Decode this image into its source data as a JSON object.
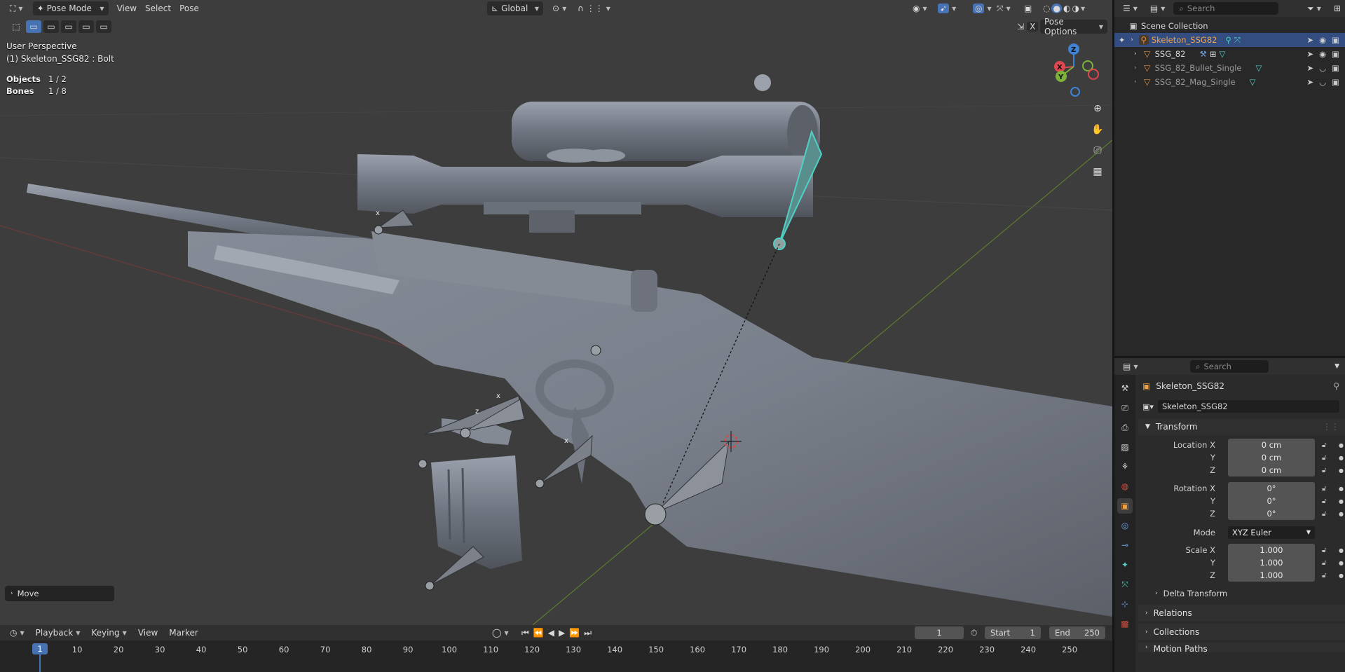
{
  "viewport": {
    "mode": "Pose Mode",
    "menus": [
      "View",
      "Select",
      "Pose"
    ],
    "orientation": "Global",
    "pose_options": "Pose Options",
    "x_toggle": "X",
    "perspective": "User Perspective",
    "active": "(1) Skeleton_SSG82 : Bolt",
    "stats": [
      {
        "label": "Objects",
        "value": "1 / 2"
      },
      {
        "label": "Bones",
        "value": "1 / 8"
      }
    ],
    "gizmo": {
      "x": "X",
      "y": "Y",
      "z": "Z"
    },
    "operator_panel": "Move",
    "bone_axis_labels": [
      "x",
      "z",
      "x",
      "x"
    ],
    "nav_icons": [
      "zoom-icon",
      "hand-icon",
      "camera-icon",
      "grid-icon"
    ]
  },
  "outliner": {
    "search_placeholder": "Search",
    "root": "Scene Collection",
    "items": [
      {
        "name": "Skeleton_SSG82",
        "selected": true
      },
      {
        "name": "SSG_82",
        "selected": false
      },
      {
        "name": "SSG_82_Bullet_Single",
        "selected": false
      },
      {
        "name": "SSG_82_Mag_Single",
        "selected": false
      }
    ]
  },
  "properties": {
    "search_placeholder": "Search",
    "object_title": "Skeleton_SSG82",
    "object_name": "Skeleton_SSG82",
    "transform_label": "Transform",
    "location": {
      "label": "Location X",
      "x": "0 cm",
      "y": "0 cm",
      "z": "0 cm"
    },
    "rotation": {
      "label": "Rotation X",
      "x": "0°",
      "y": "0°",
      "z": "0°"
    },
    "mode": {
      "label": "Mode",
      "value": "XYZ Euler"
    },
    "scale": {
      "label": "Scale X",
      "x": "1.000",
      "y": "1.000",
      "z": "1.000"
    },
    "axis_labels": {
      "y": "Y",
      "z": "Z"
    },
    "delta_transform": "Delta Transform",
    "relations": "Relations",
    "collections": "Collections",
    "motion_paths": "Motion Paths"
  },
  "timeline": {
    "menus": [
      "Playback",
      "Keying",
      "View",
      "Marker"
    ],
    "current_frame": "1",
    "start_label": "Start",
    "start": "1",
    "end_label": "End",
    "end": "250",
    "ticks": [
      "10",
      "20",
      "30",
      "40",
      "50",
      "60",
      "70",
      "80",
      "90",
      "100",
      "110",
      "120",
      "130",
      "140",
      "150",
      "160",
      "170",
      "180",
      "190",
      "200",
      "210",
      "220",
      "230",
      "240",
      "250"
    ],
    "cursor": "1"
  },
  "colors": {
    "accent": "#4772b3",
    "selection": "#334d80",
    "armature": "#e0893b",
    "bone_selected": "#4fd1c5",
    "x_axis": "#e0474e",
    "y_axis": "#7cb23a",
    "z_axis": "#3f84d4"
  }
}
